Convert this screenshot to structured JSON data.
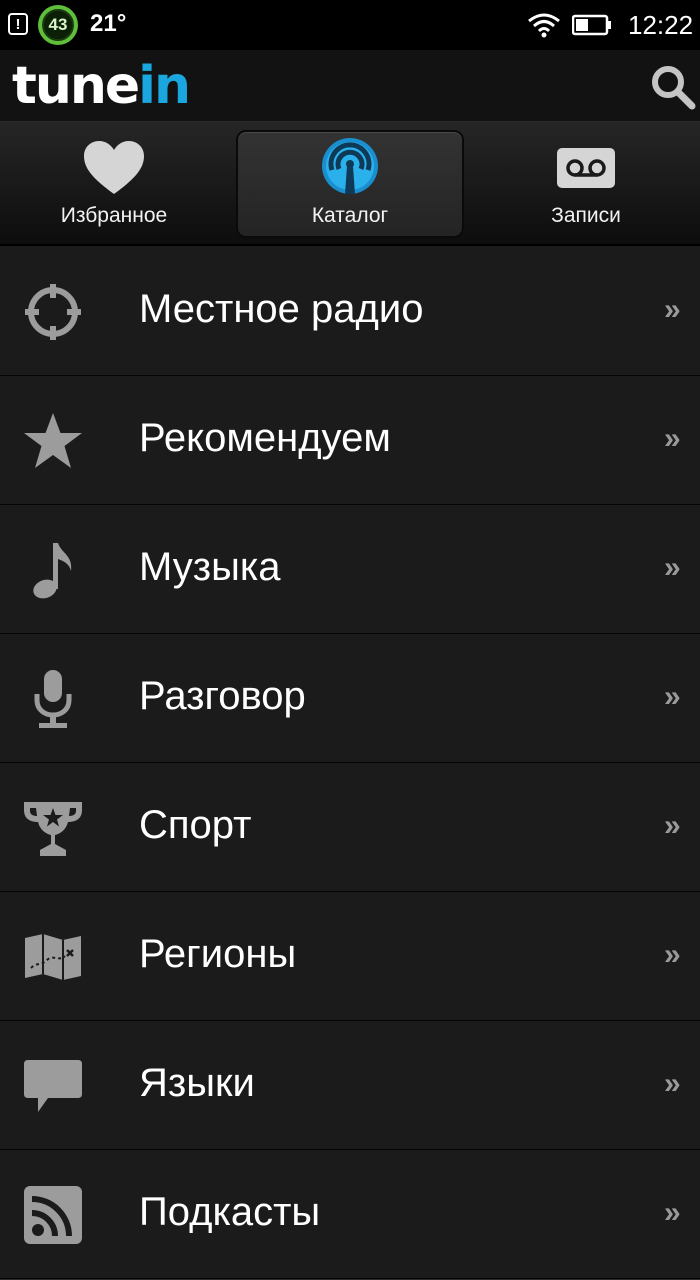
{
  "status_bar": {
    "alert": "!",
    "notification_count": "43",
    "temperature": "21°",
    "time": "12:22"
  },
  "app": {
    "logo_part1": "tune",
    "logo_part2": "in",
    "accent_color": "#1aa7e0"
  },
  "tabs": [
    {
      "label": "Избранное",
      "icon": "heart-icon",
      "active": false
    },
    {
      "label": "Каталог",
      "icon": "broadcast-icon",
      "active": true
    },
    {
      "label": "Записи",
      "icon": "voicemail-icon",
      "active": false
    }
  ],
  "menu": {
    "items": [
      {
        "label": "Местное радио",
        "icon": "crosshair-icon"
      },
      {
        "label": "Рекомендуем",
        "icon": "star-icon"
      },
      {
        "label": "Музыка",
        "icon": "music-note-icon"
      },
      {
        "label": "Разговор",
        "icon": "microphone-icon"
      },
      {
        "label": "Спорт",
        "icon": "trophy-icon"
      },
      {
        "label": "Регионы",
        "icon": "map-icon"
      },
      {
        "label": "Языки",
        "icon": "speech-bubble-icon"
      },
      {
        "label": "Подкасты",
        "icon": "rss-icon"
      }
    ],
    "chevron": "»"
  }
}
